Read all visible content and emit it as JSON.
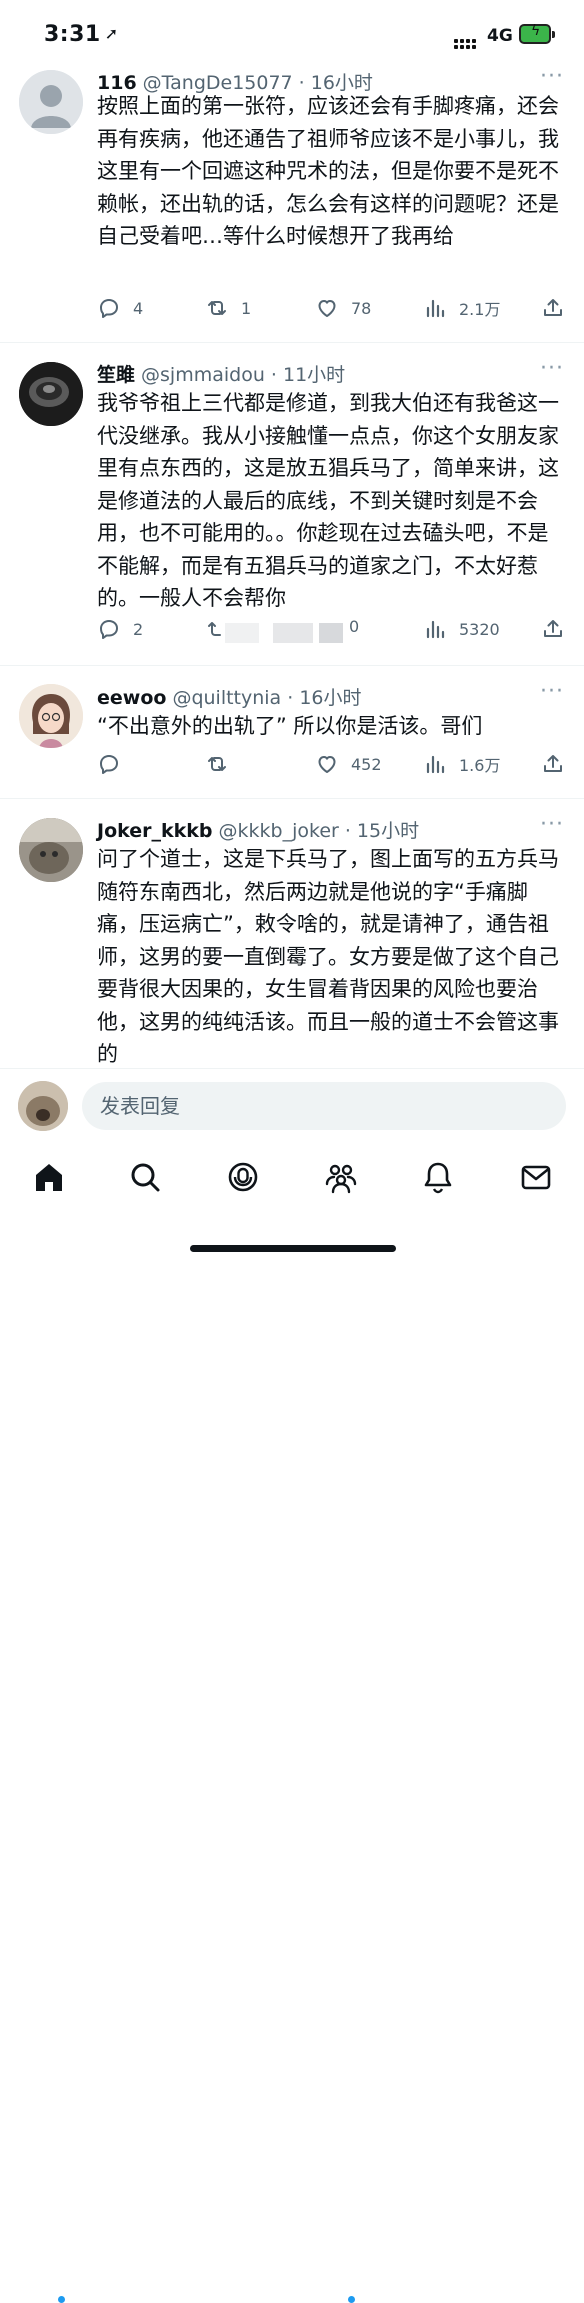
{
  "status": {
    "time": "3:31",
    "network": "4G"
  },
  "posts": [
    {
      "name": "116",
      "handle": "@TangDe15077 · 16小时",
      "text": "按照上面的第一张符，应该还会有手脚疼痛，还会再有疾病，他还通告了祖师爷应该不是小事儿，我这里有一个回遮这种咒术的法，但是你要不是死不赖帐，还出轨的话，怎么会有这样的问题呢？还是自己受着吧…等什么时候想开了我再给",
      "replies": "4",
      "reposts": "1",
      "likes": "78",
      "views": "2.1万"
    },
    {
      "name": "笙雎",
      "handle": "@sjmmaidou · 11小时",
      "text": "我爷爷祖上三代都是修道，到我大伯还有我爸这一代没继承。我从小接触懂一点点，你这个女朋友家里有点东西的，这是放五猖兵马了，简单来讲，这是修道法的人最后的底线，不到关键时刻是不会用，也不可能用的。。你趁现在过去磕头吧，不是不能解，而是有五猖兵马的道家之门，不太好惹的。一般人不会帮你",
      "replies": "2",
      "reposts": "",
      "likes": "0",
      "views": "5320"
    },
    {
      "name": "eewoo",
      "handle": "@quilttynia · 16小时",
      "text": "“不出意外的出轨了” 所以你是活该。哥们",
      "replies": "",
      "reposts": "",
      "likes": "452",
      "views": "1.6万"
    },
    {
      "name": "Joker_kkkb",
      "handle": "@kkkb_joker · 15小时",
      "text": "问了个道士，这是下兵马了，图上面写的五方兵马随符东南西北，然后两边就是他说的字“手痛脚痛，压运病亡”，敕令啥的，就是请神了，通告祖师，这男的要一直倒霉了。女方要是做了这个自己要背很大因果的，女生冒着背因果的风险也要治他，这男的纯纯活该。而且一般的道士不会管这事的"
    }
  ],
  "reply": {
    "placeholder": "发表回复"
  },
  "more_symbol": "···"
}
